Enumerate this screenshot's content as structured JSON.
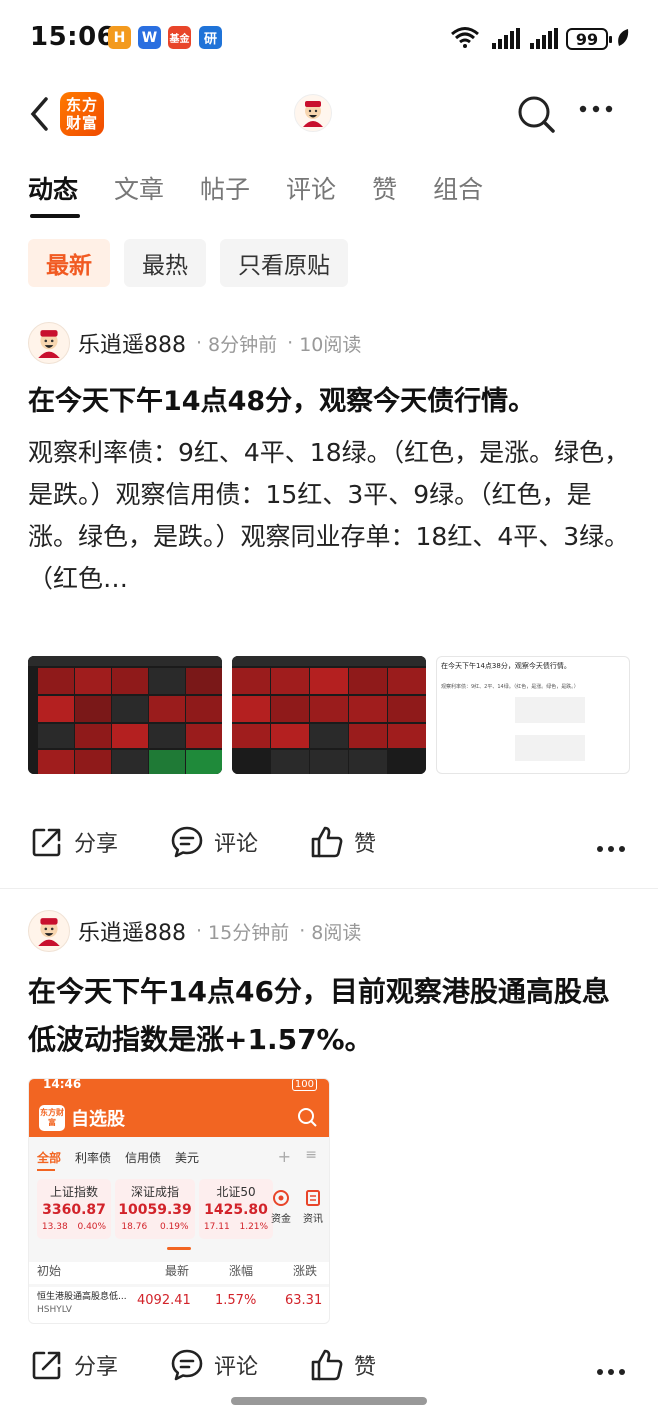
{
  "status_bar": {
    "time": "15:06",
    "apps": [
      "H",
      "W",
      "基金",
      "研"
    ],
    "battery": "99"
  },
  "nav": {
    "logo_text_1": "东方",
    "logo_text_2": "财富"
  },
  "tabs": [
    "动态",
    "文章",
    "帖子",
    "评论",
    "赞",
    "组合"
  ],
  "filters": [
    "最新",
    "最热",
    "只看原贴"
  ],
  "posts": [
    {
      "author": "乐逍遥888",
      "time": "8分钟前",
      "reads": "10阅读",
      "title": "在今天下午14点48分，观察今天债行情。",
      "body": "观察利率债：9红、4平、18绿。（红色，是涨。绿色，是跌。）观察信用债：15红、3平、9绿。（红色，是涨。绿色，是跌。）观察同业存单：18红、4平、3绿。（红色…",
      "thumb3_title": "在今天下午14点38分，观察今天债行情。",
      "thumb3_line": "观察利率债：9红、2平、14绿。（红色，是涨。绿色，是跌。）"
    },
    {
      "author": "乐逍遥888",
      "time": "15分钟前",
      "reads": "8阅读",
      "title": "在今天下午14点46分，目前观察港股通高股息低波动指数是涨+1.57%。"
    }
  ],
  "sep": "·",
  "actions": {
    "share": "分享",
    "comment": "评论",
    "like": "赞"
  },
  "mini": {
    "time": "14:46",
    "battery": "100",
    "logo": "东方财富",
    "title": "自选股",
    "tabs": [
      "全部",
      "利率债",
      "信用债",
      "美元"
    ],
    "indices": [
      {
        "name": "上证指数",
        "value": "3360.87",
        "chg": "13.38",
        "pct": "0.40%"
      },
      {
        "name": "深证成指",
        "value": "10059.39",
        "chg": "18.76",
        "pct": "0.19%"
      },
      {
        "name": "北证50",
        "value": "1425.80",
        "chg": "17.11",
        "pct": "1.21%"
      }
    ],
    "tools": [
      "资金",
      "资讯"
    ],
    "headers": [
      "初始",
      "最新",
      "涨幅",
      "涨跌"
    ],
    "row": {
      "name": "恒生港股通高股息低...",
      "code": "HSHYLV",
      "last": "4092.41",
      "pct": "1.57%",
      "chg": "63.31"
    }
  },
  "colors": {
    "accent": "#f15a22",
    "up": "#d2232a",
    "down": "#1a9c3e"
  }
}
